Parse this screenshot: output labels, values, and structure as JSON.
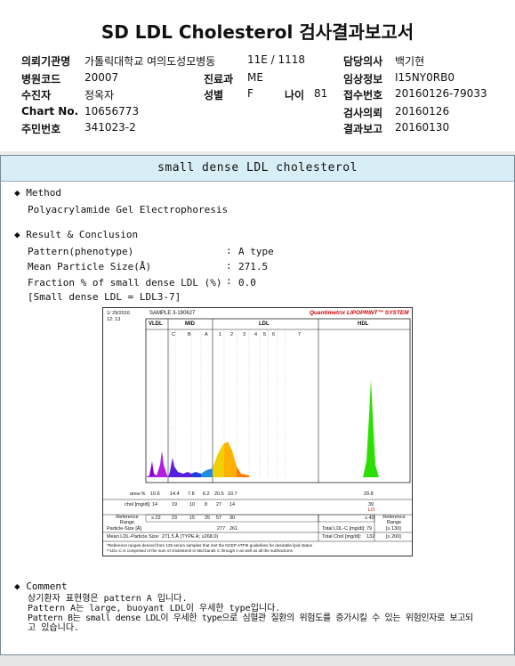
{
  "header": {
    "title": "SD LDL Cholesterol 검사결과보고서",
    "institution_label": "의뢰기관명",
    "institution_value": "가톨릭대학교 여의도성모병동",
    "ward_value": "11E / 1118",
    "doctor_label": "담당의사",
    "doctor_value": "백기현",
    "hospital_code_label": "병원코드",
    "hospital_code_value": "20007",
    "department_label": "진료과",
    "department_value": "ME",
    "clinical_label": "임상정보",
    "clinical_value": "I15NY0RB0",
    "patient_label": "수진자",
    "patient_value": "정옥자",
    "sex_label": "성별",
    "sex_value": "F",
    "age_label": "나이",
    "age_value": "81",
    "receipt_label": "접수번호",
    "receipt_value": "20160126-79033",
    "chart_label": "Chart No.",
    "chart_value": "10656773",
    "request_label": "검사의뢰",
    "request_value": "20160126",
    "rrn_label": "주민번호",
    "rrn_value": "341023-2",
    "result_label": "결과보고",
    "result_value": "20160130"
  },
  "report": {
    "band_title": "small dense LDL cholesterol",
    "method_heading": "Method",
    "method_text": "Polyacrylamide Gel Electrophoresis",
    "result_heading": "Result & Conclusion",
    "pattern_label": "Pattern(phenotype)",
    "pattern_value": "A type",
    "size_label": "Mean Particle Size(Å)",
    "size_value": "271.5",
    "fraction_label": "Fraction % of small dense LDL (%)",
    "fraction_value": "0.0",
    "sdldl_note": "[Small dense LDL = LDL3-7]",
    "comment_heading": "Comment",
    "comment_line1": "상기환자 표현형은 pattern A 입니다.",
    "comment_line2": "Pattern A는 large, buoyant LDL이 우세한 type입니다.",
    "comment_line3": "Pattern B는 small dense LDL이 우세한 type으로 심혈관 질환의 위험도를 증가시킬 수 있는 위험인자로 보고되",
    "comment_line4": "고 있습니다."
  },
  "lipoprint": {
    "date": "1/ 29/2016",
    "time": "12: 13",
    "sample": "SAMPLE    3-190627",
    "brand": "Quantimetrix LIPOPRINT™ SYSTEM",
    "band_vldl": "VLDL",
    "band_mid": "MID",
    "band_ldl": "LDL",
    "band_hdl": "HDL",
    "mid_sub": [
      "C",
      "B",
      "A"
    ],
    "ldl_sub": [
      "1",
      "2",
      "3",
      "4",
      "5",
      "6",
      "7"
    ],
    "area_label": "area %",
    "area_values": [
      "10.6",
      "14.4",
      "7.8",
      "6.2",
      "20.5",
      "10.7"
    ],
    "area_hdl": "29.8",
    "chol_label": "chol [mg/dl]",
    "chol_values": [
      "14",
      "19",
      "10",
      "8",
      "27",
      "14"
    ],
    "chol_hdl": "39",
    "chol_hdl_flag": "LO",
    "ref_label": "Reference Range",
    "ref_values": [
      "≤ 22",
      "23",
      "15",
      "25",
      "57",
      "30"
    ],
    "ref_hdl": "≥ 40",
    "ref2_label": "Reference Range",
    "particle_label": "Particle-Size [Å]",
    "particle_values": [
      "277",
      "261"
    ],
    "mean_label": "Mean LDL-Particle Size:",
    "mean_value": "271.5 Å  (TYPE A;  ≥268.0)",
    "total_ldl_label": "Total LDL-C [mg/dl]:",
    "total_ldl_value": "79",
    "total_ldl_ref": "[≤ 130]",
    "total_chol_label": "Total Chol [mg/dl]:",
    "total_chol_value": "132",
    "total_chol_ref": "[≤ 200]",
    "footnote1": "*Reference ranges derived from 125 serum samples that met the NCEP ATPIII guidelines for desirable lipid status",
    "footnote2": "**LDL-C is comprised of the sum of cholesterol in Mid bands C through A as well as all the subfractions"
  }
}
